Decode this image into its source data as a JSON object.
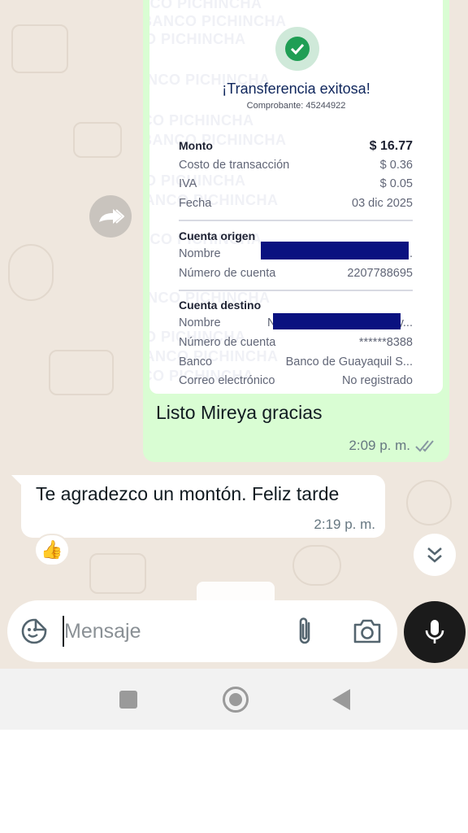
{
  "receipt": {
    "watermark": "BANCO PICHINCHA",
    "title": "¡Transferencia exitosa!",
    "comprobante": "Comprobante: 45244922",
    "monto_label": "Monto",
    "monto_value": "$ 16.77",
    "costo_label": "Costo de transacción",
    "costo_value": "$ 0.36",
    "iva_label": "IVA",
    "iva_value": "$ 0.05",
    "fecha_label": "Fecha",
    "fecha_value": "03 dic 2025",
    "origen_heading": "Cuenta origen",
    "origen_nombre_label": "Nombre",
    "origen_nombre_value": "...",
    "origen_cuenta_label": "Número de cuenta",
    "origen_cuenta_value": "2207788695",
    "destino_heading": "Cuenta destino",
    "destino_nombre_label": "Nombre",
    "destino_nombre_prefix": "N",
    "destino_nombre_suffix": "y...",
    "destino_cuenta_label": "Número de cuenta",
    "destino_cuenta_value": "******8388",
    "banco_label": "Banco",
    "banco_value": "Banco de Guayaquil S...",
    "correo_label": "Correo electrónico",
    "correo_value": "No registrado"
  },
  "outgoing": {
    "text": "Listo Mireya gracias",
    "time": "2:09 p. m."
  },
  "incoming": {
    "text": "Te agradezco un montón. Feliz tarde",
    "time": "2:19 p. m.",
    "reaction": "👍"
  },
  "composer": {
    "placeholder": "Mensaje"
  },
  "icons": {
    "forward": "forward-icon",
    "check": "check-icon",
    "read_receipt": "double-check-icon",
    "scroll_down": "double-chevron-down-icon",
    "emoji": "sticker-icon",
    "attach": "paperclip-icon",
    "camera": "camera-icon",
    "mic": "microphone-icon"
  },
  "colors": {
    "wallpaper": "#efe7de",
    "outgoing_bubble": "#d9fdd3",
    "bank_navy": "#0f265c",
    "success_green": "#1f9e54",
    "redaction": "#0a1280"
  }
}
